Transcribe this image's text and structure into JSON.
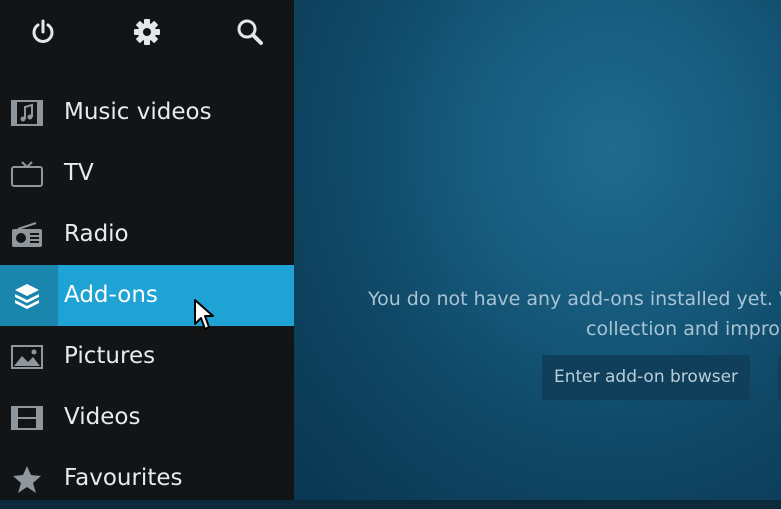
{
  "topbar": {
    "power": "power-icon",
    "settings": "gear-icon",
    "search": "search-icon"
  },
  "menu": {
    "items": [
      {
        "label": "Music videos",
        "icon": "music-video-icon"
      },
      {
        "label": "TV",
        "icon": "tv-icon"
      },
      {
        "label": "Radio",
        "icon": "radio-icon"
      },
      {
        "label": "Add-ons",
        "icon": "addons-box-icon",
        "active": true
      },
      {
        "label": "Pictures",
        "icon": "picture-icon"
      },
      {
        "label": "Videos",
        "icon": "film-icon"
      },
      {
        "label": "Favourites",
        "icon": "star-icon"
      }
    ]
  },
  "main": {
    "message_line1": "You do not have any add-ons installed yet. V",
    "message_line2": "collection and improv",
    "browser_button": "Enter add-on browser"
  },
  "colors": {
    "sidebar": "#121416",
    "accent": "#1fa3d5",
    "background": "#175c7e"
  }
}
